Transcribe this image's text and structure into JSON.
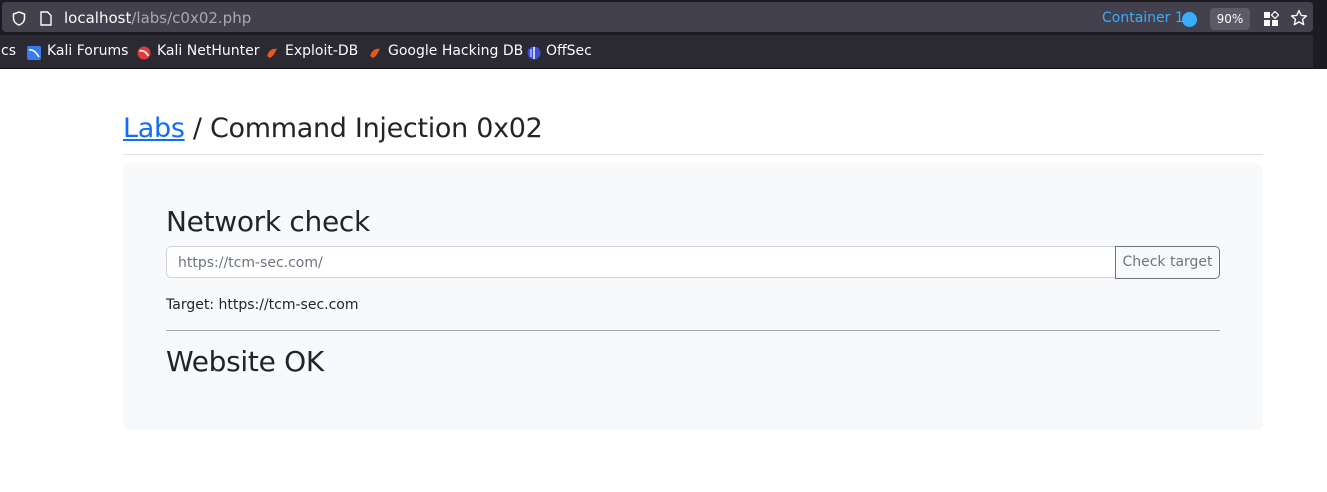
{
  "browser": {
    "url_host": "localhost",
    "url_path": "/labs/c0x02.php",
    "container_label": "Container 1",
    "zoom": "90%",
    "bookmarks": [
      {
        "label": "cs",
        "icon": ""
      },
      {
        "label": "Kali Forums",
        "icon": "kali-forums-icon"
      },
      {
        "label": "Kali NetHunter",
        "icon": "kali-nethunter-icon"
      },
      {
        "label": "Exploit-DB",
        "icon": "exploit-db-icon"
      },
      {
        "label": "Google Hacking DB",
        "icon": "google-hacking-db-icon"
      },
      {
        "label": "OffSec",
        "icon": "offsec-icon"
      }
    ]
  },
  "page": {
    "breadcrumb_link": "Labs",
    "breadcrumb_rest": " / Command Injection 0x02",
    "section_title": "Network check",
    "input_value": "https://tcm-sec.com/",
    "button_label": "Check target",
    "target_text": "Target: https://tcm-sec.com",
    "status_text": "Website OK"
  },
  "colors": {
    "link": "#0d6efd",
    "container_accent": "#37adff",
    "card_bg": "#f8f9fa"
  }
}
